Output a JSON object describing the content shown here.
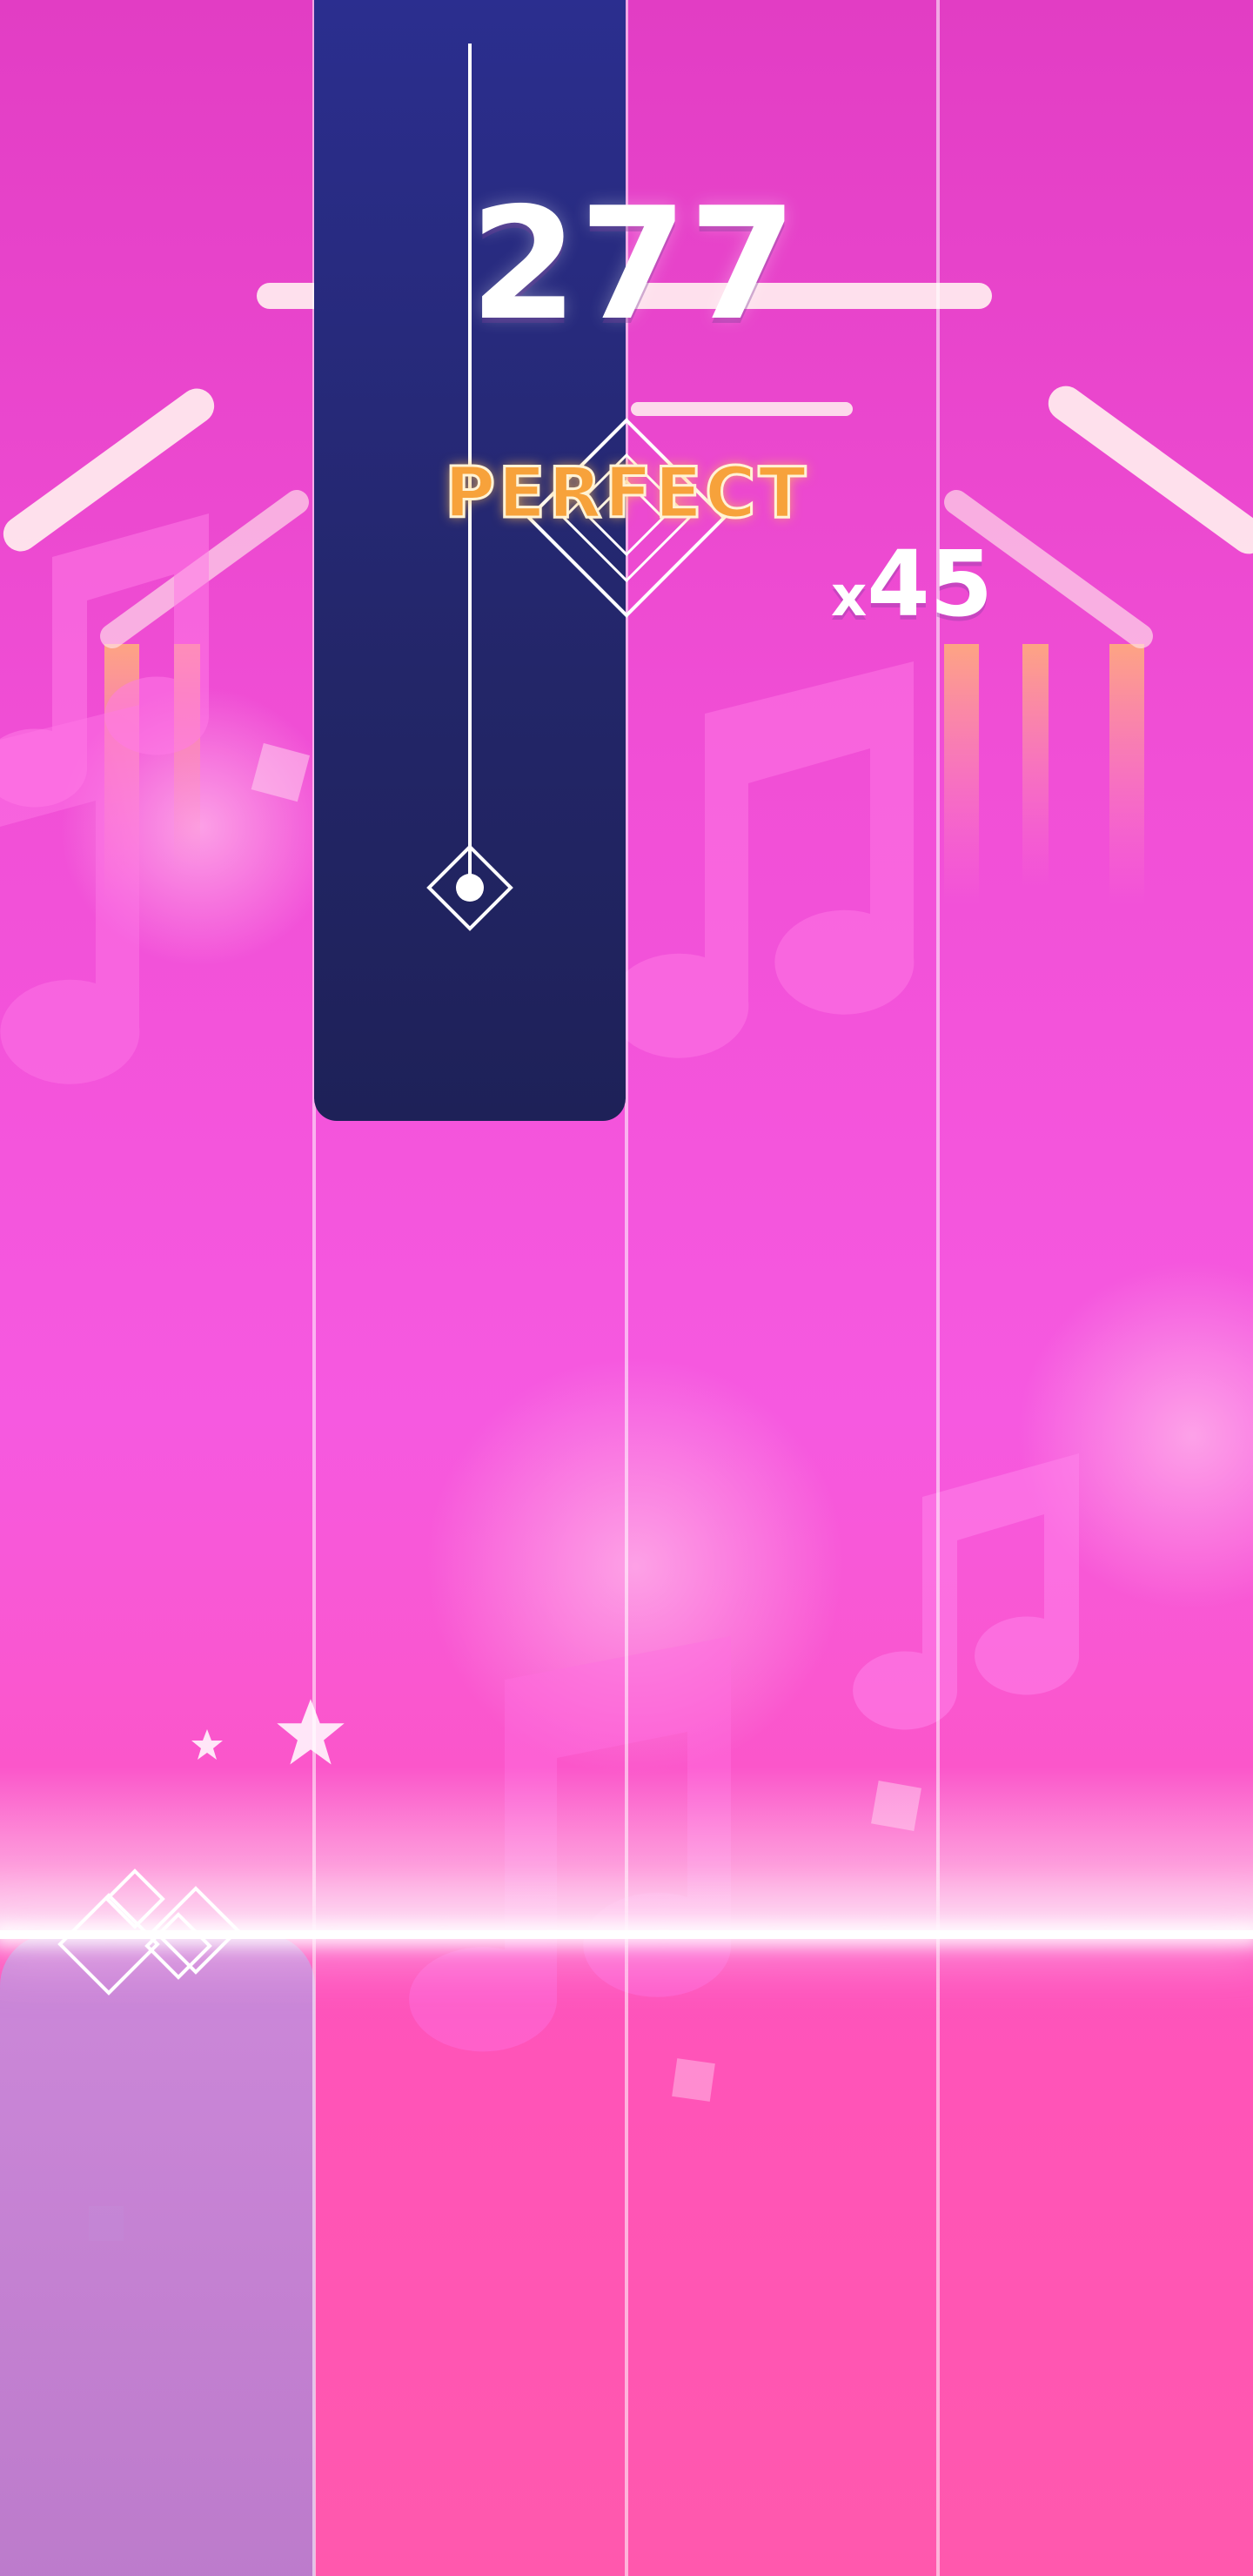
{
  "hud": {
    "score": "277",
    "rating": "PERFECT",
    "combo_prefix": "x",
    "combo_count": "45"
  },
  "colors": {
    "background_top": "#e23dc4",
    "background_bottom": "#ff58ad",
    "tile": "#262a78",
    "pressed_tile": "#c48ad8",
    "rating": "#f7a23b"
  },
  "icons": {
    "note_decor": "music-note-icon",
    "diamond": "diamond-icon",
    "star": "star-icon"
  }
}
